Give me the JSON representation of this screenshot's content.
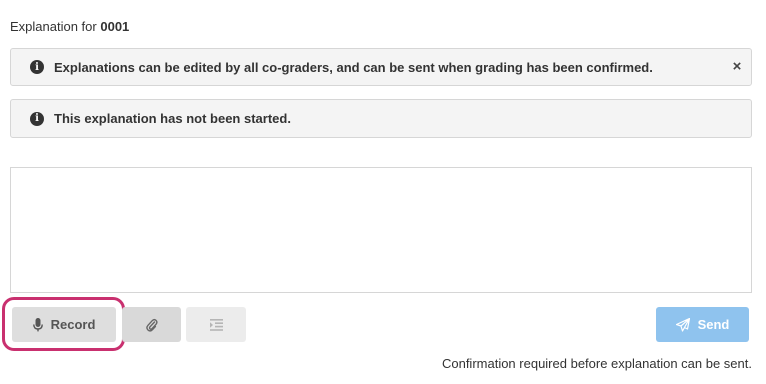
{
  "header": {
    "prefix": "Explanation for",
    "submission_number": "0001"
  },
  "alerts": [
    {
      "icon": "info-circle-icon",
      "text": "Explanations can be edited by all co-graders, and can be sent when grading has been confirmed.",
      "dismissible": true,
      "close_icon": "close-x-icon"
    },
    {
      "icon": "info-circle-icon",
      "text": "This explanation has not been started.",
      "dismissible": false
    }
  ],
  "editor": {
    "value": "",
    "placeholder": ""
  },
  "toolbar": {
    "record": {
      "label": "Record",
      "icon": "microphone-icon",
      "highlighted": true,
      "highlight_color": "#c9306f"
    },
    "attach": {
      "icon": "paperclip-icon"
    },
    "indent": {
      "icon": "indent-icon",
      "disabled": true
    },
    "send": {
      "label": "Send",
      "icon": "paper-plane-icon",
      "disabled": true,
      "color": "#8fc3ee"
    }
  },
  "footer": {
    "note": "Confirmation required before explanation can be sent."
  }
}
